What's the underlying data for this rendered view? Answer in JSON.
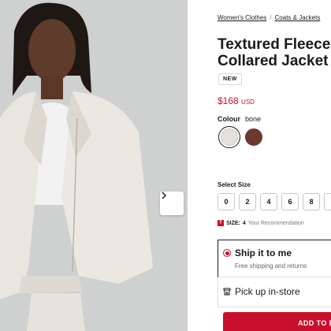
{
  "breadcrumb": {
    "items": [
      "Women's Clothes",
      "Coats & Jackets"
    ]
  },
  "product": {
    "title_line1": "Textured Fleece",
    "title_line2": "Collared Jacket",
    "badge": "NEW",
    "price": "$168",
    "currency": "USD"
  },
  "colour": {
    "label": "Colour",
    "selected": "bone",
    "swatches": [
      {
        "name": "bone",
        "hex": "#e4e0da"
      },
      {
        "name": "brown",
        "hex": "#6b3a2e"
      }
    ]
  },
  "size": {
    "label": "Select Size",
    "options": [
      "0",
      "2",
      "4",
      "6",
      "8",
      "1"
    ],
    "fit_prefix": "SIZE:",
    "fit_value": "4",
    "fit_note": "Your Recommendation"
  },
  "delivery": {
    "ship_title": "Ship it to me",
    "ship_sub": "Free shipping and returns",
    "pickup_title": "Pick up in-store"
  },
  "cart": {
    "label": "ADD TO B"
  },
  "colors": {
    "accent": "#c8102e",
    "photo_bg": "#cfd0d0"
  },
  "icons": {
    "next": "chevron-right-icon",
    "store": "store-icon",
    "size_tag": "size-tag-icon"
  }
}
